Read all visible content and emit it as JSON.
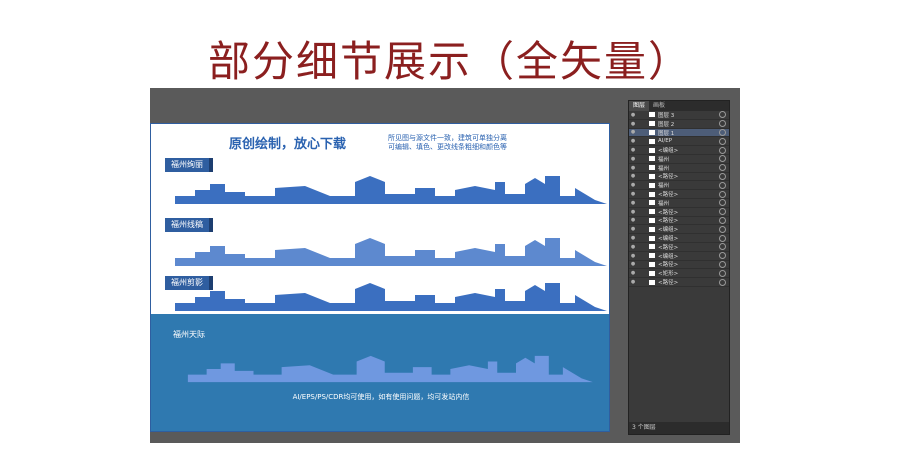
{
  "headline": "部分细节展示（全矢量）",
  "artboard": {
    "title": "原创绘制，放心下载",
    "notes": [
      "所见图与源文件一致，建筑可单独分离",
      "可编辑、填色、更改线条粗细和颜色等"
    ],
    "rows": [
      {
        "label": "福州绚丽"
      },
      {
        "label": "福州线稿"
      },
      {
        "label": "福州剪影"
      }
    ],
    "night_label": "福州天际",
    "footer": "AI/EPS/PS/CDR均可使用，如有使用问题，均可发站内信"
  },
  "layers_panel": {
    "tabs": [
      "图层",
      "画板"
    ],
    "layers": [
      {
        "name": "图层 3",
        "selected": false
      },
      {
        "name": "图层 2",
        "selected": false
      },
      {
        "name": "图层 1",
        "selected": true
      },
      {
        "name": "AI/EP",
        "selected": false
      },
      {
        "name": "<编组>",
        "selected": false
      },
      {
        "name": "福州",
        "selected": false
      },
      {
        "name": "福州",
        "selected": false
      },
      {
        "name": "<路径>",
        "selected": false
      },
      {
        "name": "福州",
        "selected": false
      },
      {
        "name": "<路径>",
        "selected": false
      },
      {
        "name": "福州",
        "selected": false
      },
      {
        "name": "<路径>",
        "selected": false
      },
      {
        "name": "<路径>",
        "selected": false
      },
      {
        "name": "<编组>",
        "selected": false
      },
      {
        "name": "<编组>",
        "selected": false
      },
      {
        "name": "<路径>",
        "selected": false
      },
      {
        "name": "<编组>",
        "selected": false
      },
      {
        "name": "<路径>",
        "selected": false
      },
      {
        "name": "<矩形>",
        "selected": false
      },
      {
        "name": "<路径>",
        "selected": false
      }
    ],
    "footer": "3 个图层"
  }
}
